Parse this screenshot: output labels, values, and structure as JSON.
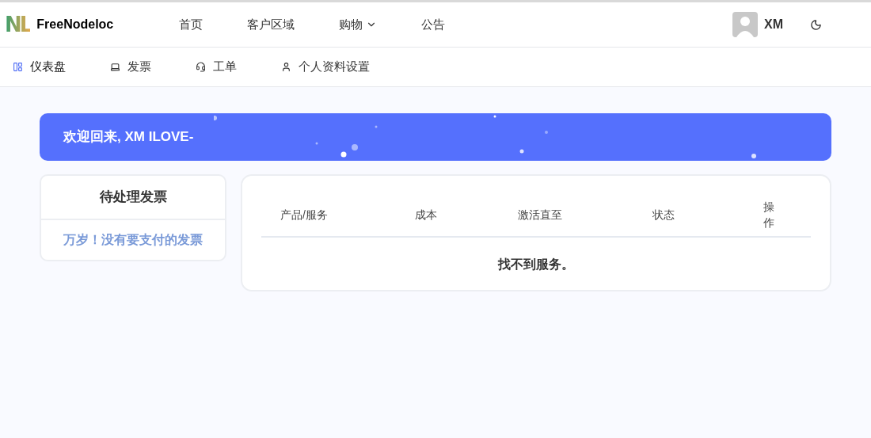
{
  "header": {
    "logo": "NL",
    "brand": "FreeNodeloc",
    "nav": [
      {
        "label": "首页",
        "kind": "link"
      },
      {
        "label": "客户区域",
        "kind": "link"
      },
      {
        "label": "购物",
        "kind": "dropdown"
      },
      {
        "label": "公告",
        "kind": "link"
      }
    ],
    "user": "XM"
  },
  "subnav": [
    {
      "label": "仪表盘",
      "kind": "dashboard",
      "selected": true
    },
    {
      "label": "发票",
      "kind": "invoices",
      "selected": false
    },
    {
      "label": "工单",
      "kind": "tickets",
      "selected": false
    },
    {
      "label": "个人资料设置",
      "kind": "profile",
      "selected": false
    }
  ],
  "banner": {
    "text": "欢迎回来, XM ILOVE-"
  },
  "invoices": {
    "title": "待处理发票",
    "message": "万岁！没有要支付的发票"
  },
  "services": {
    "columns": [
      "产品/服务",
      "成本",
      "激活直至",
      "状态",
      "操作"
    ],
    "empty": "找不到服务。"
  }
}
